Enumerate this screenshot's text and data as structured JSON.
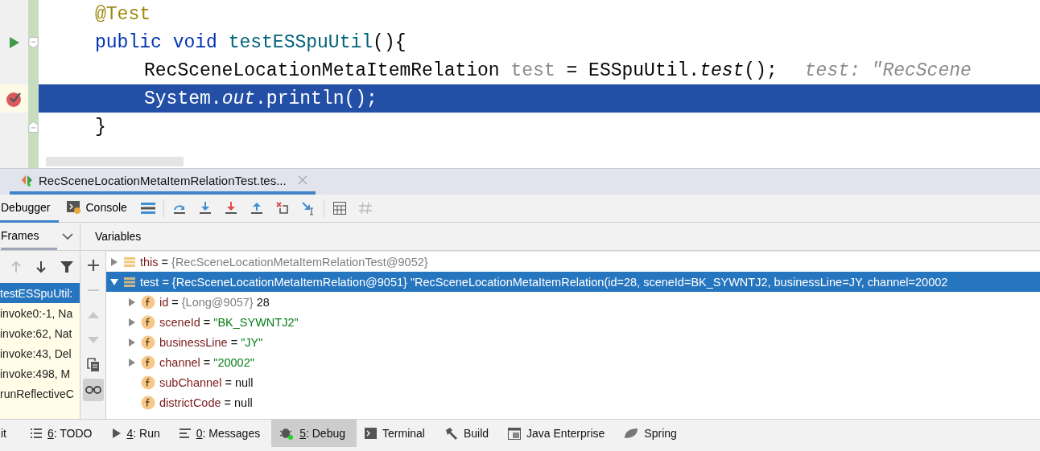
{
  "editor": {
    "lines": [
      {
        "indented": false,
        "highlighted": false,
        "tokens": [
          {
            "text": "@Test",
            "kind": "annotation"
          }
        ]
      },
      {
        "indented": false,
        "run_marker": true,
        "highlighted": false,
        "fold_start": true,
        "tokens": [
          {
            "text": "public ",
            "kind": "keyword"
          },
          {
            "text": "void ",
            "kind": "keyword"
          },
          {
            "text": "testESSpuUtil",
            "kind": "declaration"
          },
          {
            "text": "(){",
            "kind": "plain"
          }
        ]
      },
      {
        "indented": true,
        "highlighted": false,
        "tokens": [
          {
            "text": "RecSceneLocationMetaItemRelation ",
            "kind": "plain"
          },
          {
            "text": "test",
            "kind": "unused"
          },
          {
            "text": " = ESSpuUtil.",
            "kind": "plain"
          },
          {
            "text": "test",
            "kind": "static"
          },
          {
            "text": "();",
            "kind": "plain"
          },
          {
            "text": "test: \"RecScene",
            "kind": "hint"
          }
        ]
      },
      {
        "indented": true,
        "breakpoint": true,
        "highlighted": true,
        "tokens": [
          {
            "text": "System.",
            "kind": "plain"
          },
          {
            "text": "out",
            "kind": "static"
          },
          {
            "text": ".println();",
            "kind": "plain"
          }
        ]
      },
      {
        "indented": false,
        "highlighted": false,
        "fold_end": true,
        "tokens": [
          {
            "text": "}",
            "kind": "plain"
          }
        ]
      }
    ]
  },
  "debug_tab": {
    "title": "RecSceneLocationMetaItemRelationTest.tes...",
    "selected": true
  },
  "toolbar": {
    "tabs": [
      {
        "label": "Debugger",
        "selected": true,
        "kind": "plain"
      },
      {
        "label": "Console",
        "selected": false,
        "kind": "console"
      }
    ]
  },
  "frames": {
    "title": "Frames",
    "items": [
      {
        "label": "testESSpuUtil:",
        "selected": true
      },
      {
        "label": "invoke0:-1, Na",
        "selected": false
      },
      {
        "label": "invoke:62, Nat",
        "selected": false
      },
      {
        "label": "invoke:43, Del",
        "selected": false
      },
      {
        "label": "invoke:498, M",
        "selected": false
      },
      {
        "label": "runReflectiveC",
        "selected": false
      }
    ]
  },
  "variables": {
    "title": "Variables",
    "items": [
      {
        "kind": "object",
        "name": "this",
        "operator": "=",
        "ref": "{RecSceneLocationMetaItemRelationTest@9052}",
        "expanded": false,
        "selected": false
      },
      {
        "kind": "object",
        "name": "test",
        "operator": "=",
        "ref": "{RecSceneLocationMetaItemRelation@9051}",
        "value": "\"RecSceneLocationMetaItemRelation(id=28, sceneId=BK_SYWNTJ2, businessLine=JY, channel=20002",
        "expanded": true,
        "selected": true,
        "children": [
          {
            "kind": "field",
            "name": "id",
            "operator": "=",
            "ref": "{Long@9057}",
            "value": "28",
            "string": false,
            "expanded": false,
            "selected": false
          },
          {
            "kind": "field",
            "name": "sceneId",
            "operator": "=",
            "value": "\"BK_SYWNTJ2\"",
            "string": true,
            "expanded": false,
            "selected": false
          },
          {
            "kind": "field",
            "name": "businessLine",
            "operator": "=",
            "value": "\"JY\"",
            "string": true,
            "expanded": false,
            "selected": false
          },
          {
            "kind": "field",
            "name": "channel",
            "operator": "=",
            "value": "\"20002\"",
            "string": true,
            "expanded": false,
            "selected": false
          },
          {
            "kind": "field",
            "name": "subChannel",
            "operator": "=",
            "value": "null",
            "string": false,
            "selected": false
          },
          {
            "kind": "field",
            "name": "districtCode",
            "operator": "=",
            "value": "null",
            "string": false,
            "selected": false
          }
        ]
      }
    ]
  },
  "tool_windows": [
    {
      "kind": "none",
      "label": "it",
      "selected": false
    },
    {
      "kind": "list",
      "key": "6",
      "label": ": TODO",
      "selected": false
    },
    {
      "kind": "run",
      "key": "4",
      "label": ": Run",
      "selected": false
    },
    {
      "kind": "messages",
      "key": "0",
      "label": ": Messages",
      "selected": false
    },
    {
      "kind": "debug",
      "key": "5",
      "label": ": Debug",
      "selected": true
    },
    {
      "kind": "terminal",
      "label": "Terminal",
      "selected": false
    },
    {
      "kind": "build",
      "label": "Build",
      "selected": false
    },
    {
      "kind": "enterprise",
      "label": "Java Enterprise",
      "selected": false
    },
    {
      "kind": "spring",
      "label": "Spring",
      "selected": false
    }
  ]
}
